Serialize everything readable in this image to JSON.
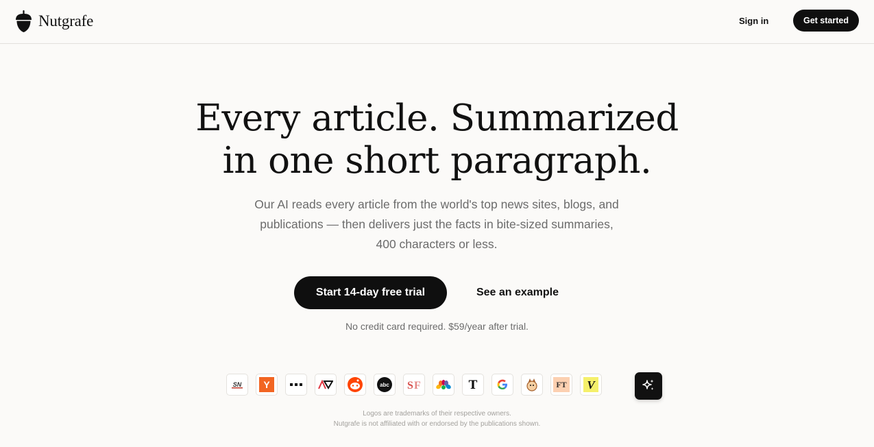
{
  "header": {
    "brand_name": "Nutgrafe",
    "sign_in_label": "Sign in",
    "get_started_label": "Get started"
  },
  "hero": {
    "headline_line1": "Every article. Summarized",
    "headline_line2": "in one short paragraph.",
    "subhead_line1": "Our AI reads every article from the world's top news sites, blogs, and",
    "subhead_line2": "publications — then delivers just the facts in bite-sized summaries,",
    "subhead_line3": "400 characters or less.",
    "primary_cta": "Start 14-day free trial",
    "secondary_cta": "See an example",
    "note": "No credit card required. $59/year after trial."
  },
  "logos": {
    "items": [
      {
        "name": "sn",
        "text": "SN"
      },
      {
        "name": "y",
        "text": "Y"
      },
      {
        "name": "dots",
        "text": "•••"
      },
      {
        "name": "av",
        "text": "AV"
      },
      {
        "name": "reddit",
        "text": ""
      },
      {
        "name": "abc",
        "text": "abc"
      },
      {
        "name": "sf",
        "text": "SF"
      },
      {
        "name": "nbc",
        "text": ""
      },
      {
        "name": "nyt",
        "text": "T"
      },
      {
        "name": "google",
        "text": "G"
      },
      {
        "name": "squirrel",
        "text": ""
      },
      {
        "name": "ft",
        "text": "FT"
      },
      {
        "name": "v",
        "text": "V"
      }
    ],
    "sparkle_icon": "sparkle-icon"
  },
  "footer": {
    "disclaimer_line1": "Logos are trademarks of their respective owners.",
    "disclaimer_line2": "Nutgrafe is not affiliated with or endorsed by the publications shown."
  },
  "colors": {
    "background": "#fbfaf8",
    "button_dark": "#0f0f0f",
    "text_muted": "#6b6b6b"
  }
}
